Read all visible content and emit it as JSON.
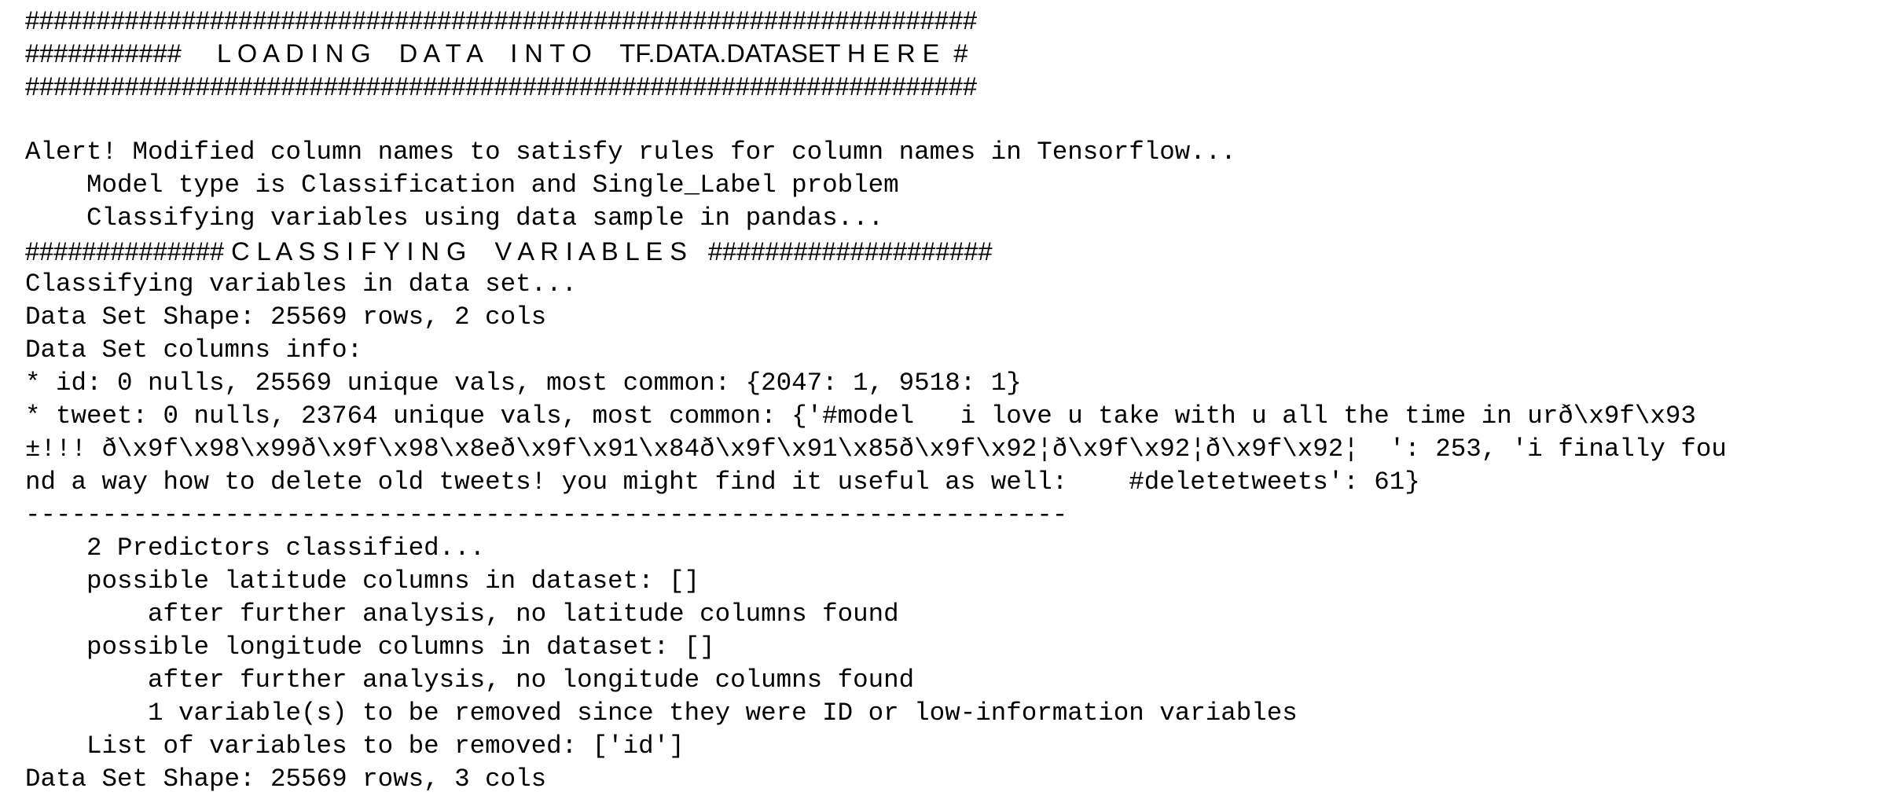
{
  "console": {
    "lines": [
      "###################################################################",
      "###########     L O A D I N G    D A T A    I N T O    TF.DATA.DATASET H E R E  #",
      "###################################################################",
      "",
      "Alert! Modified column names to satisfy rules for column names in Tensorflow...",
      "    Model type is Classification and Single_Label problem",
      "    Classifying variables using data sample in pandas...",
      "############## C L A S S I F Y I N G    V A R I A B L E S   ####################",
      "Classifying variables in data set...",
      "Data Set Shape: 25569 rows, 2 cols",
      "Data Set columns info:",
      "* id: 0 nulls, 25569 unique vals, most common: {2047: 1, 9518: 1}",
      "* tweet: 0 nulls, 23764 unique vals, most common: {'#model   i love u take with u all the time in urð\\x9f\\x93",
      "±!!! ð\\x9f\\x98\\x99ð\\x9f\\x98\\x8eð\\x9f\\x91\\x84ð\\x9f\\x91\\x85ð\\x9f\\x92¦ð\\x9f\\x92¦ð\\x9f\\x92¦  ': 253, 'i finally fou",
      "nd a way how to delete old tweets! you might find it useful as well:    #deletetweets': 61}",
      "--------------------------------------------------------------------",
      "    2 Predictors classified...",
      "    possible latitude columns in dataset: []",
      "        after further analysis, no latitude columns found",
      "    possible longitude columns in dataset: []",
      "        after further analysis, no longitude columns found",
      "        1 variable(s) to be removed since they were ID or low-information variables",
      "    List of variables to be removed: ['id']",
      "Data Set Shape: 25569 rows, 3 cols"
    ]
  }
}
